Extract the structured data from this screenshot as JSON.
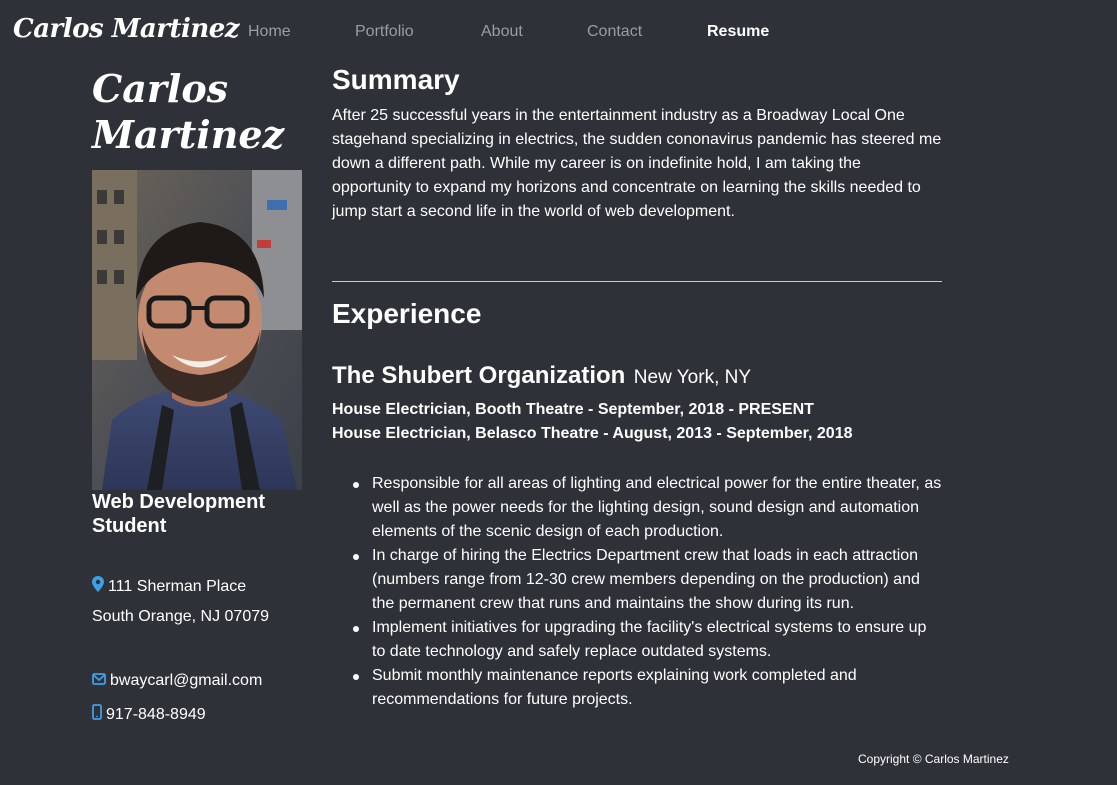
{
  "nav": {
    "brand": "Carlos Martinez",
    "links": [
      {
        "label": "Home"
      },
      {
        "label": "Portfolio"
      },
      {
        "label": "About"
      },
      {
        "label": "Contact"
      },
      {
        "label": "Resume",
        "active": true
      }
    ]
  },
  "sidebar": {
    "name": "Carlos Martinez",
    "photo_alt": "Portrait photo",
    "role": "Web Development Student",
    "address_line1": "111 Sherman Place",
    "address_line2": "South Orange, NJ 07079",
    "email": "bwaycarl@gmail.com",
    "phone": "917-848-8949",
    "icon_color": "#3ea0e6",
    "icons": {
      "address": "map-marker-icon",
      "email": "envelope-icon",
      "phone": "mobile-phone-icon"
    }
  },
  "summary": {
    "heading": "Summary",
    "text": "After 25 successful years in the entertainment industry as a Broadway Local One stagehand specializing in electrics, the sudden cononavirus pandemic has steered me down a different path. While my career is on indefinite hold, I am taking the opportunity to expand my horizons and concentrate on learning the skills needed to jump start a second life in the world of web development."
  },
  "experience": {
    "heading": "Experience",
    "employer": "The Shubert Organization",
    "location": "New York, NY",
    "positions": [
      "House Electrician, Booth Theatre - September, 2018 - PRESENT",
      "House Electrician, Belasco Theatre - August, 2013 - September, 2018"
    ],
    "duties": [
      "Responsible for all areas of lighting and electrical power for the entire theater, as well as the power needs for the lighting design, sound design and automation elements of the scenic design of each production.",
      "In charge of hiring the Electrics Department crew that loads in each attraction (numbers range from 12-30 crew members depending on the production) and the permanent crew that runs and maintains the show during its run.",
      "Implement initiatives for upgrading the facility's electrical systems to ensure up to date technology and safely replace outdated systems.",
      "Submit monthly maintenance reports explaining work completed and recommendations for future projects."
    ]
  },
  "footer": {
    "copyright": "Copyright © Carlos Martinez"
  },
  "colors": {
    "background": "#2e3138",
    "text": "#ffffff",
    "nav_inactive": "#9a9da2",
    "accent_icon": "#3ea0e6"
  }
}
